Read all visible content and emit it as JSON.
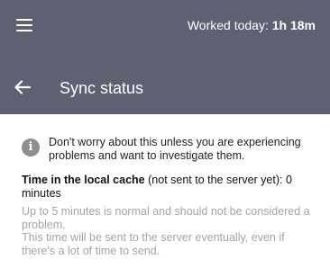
{
  "header": {
    "worked_label": "Worked today:",
    "worked_value": "1h 18m",
    "title": "Sync status"
  },
  "info": {
    "icon": "info-icon",
    "text": "Don't worry about this unless you are experiencing problems and want to investigate them."
  },
  "cache": {
    "label": "Time in the local cache",
    "qualifier": "(not sent to the server yet): 0 minutes"
  },
  "note": {
    "line1": "Up to 5 minutes is normal and should not be considered a problem.",
    "line2": "This time will be sent to the server eventually, even if there's a lot of time to send."
  },
  "colors": {
    "header_bg": "#5f6172",
    "header_text": "#ffffff",
    "muted_text": "#a4a4a4",
    "info_icon": "#8e8e8e"
  }
}
